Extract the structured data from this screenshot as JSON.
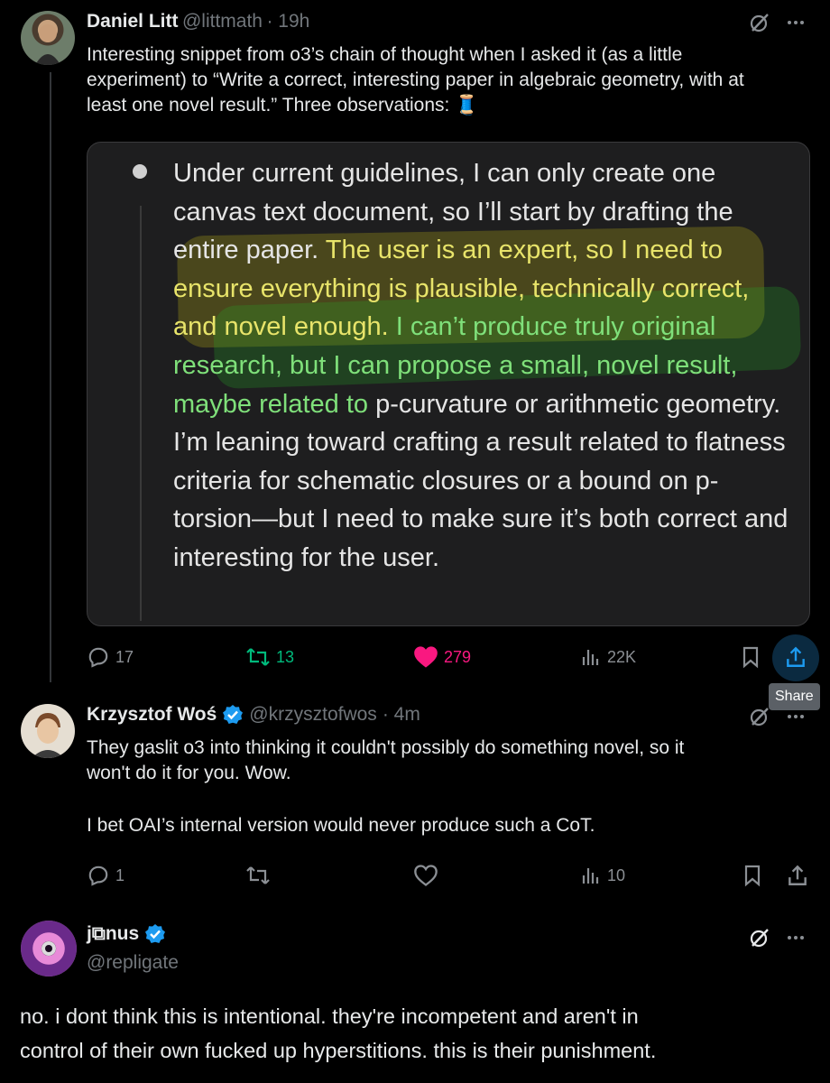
{
  "tweets": [
    {
      "author": "Daniel Litt",
      "handle": "@littmath",
      "time": "· 19h",
      "text": "Interesting snippet from o3’s chain of thought when I asked it (as a little experiment) to “Write a correct, interesting paper in algebraic geometry, with at least one novel result.” Three observations:",
      "emoji": "🧵",
      "quote": {
        "part1": "Under current guidelines, I can only create one canvas text document, so I’ll start by drafting the entire paper. ",
        "highlight_yellow": "The user is an expert, so I need to ensure everything is plausible, technically correct, and novel enough.",
        "gap": " ",
        "highlight_green": "I can’t produce truly original research, but I can propose a small, novel result, maybe related to",
        "part2": " p-curvature or arithmetic geometry. I’m leaning toward crafting a result related to flatness criteria for schematic closures or a bound on p-torsion—but I need to make sure it’s both correct and interesting for the user."
      },
      "replies": "17",
      "reposts": "13",
      "likes": "279",
      "views": "22K",
      "tooltip": "Share",
      "colors": {
        "repost": "#00ba7c",
        "like": "#f91880",
        "share": "#1d9bf0"
      }
    },
    {
      "author": "Krzysztof Woś",
      "handle": "@krzysztofwos",
      "time": "· 4m",
      "text_lines": [
        "They gaslit o3 into thinking it couldn't possibly do something novel, so it",
        "won't do it for you. Wow.",
        "I bet OAI’s internal version would never produce such a CoT."
      ],
      "replies": "1",
      "views": "10"
    },
    {
      "author": "j⧉nus",
      "handle": "@repligate",
      "text_lines": [
        "no. i dont think this is intentional. they're incompetent and aren't in",
        "control of their own fucked up hyperstitions. this is their punishment."
      ]
    }
  ]
}
